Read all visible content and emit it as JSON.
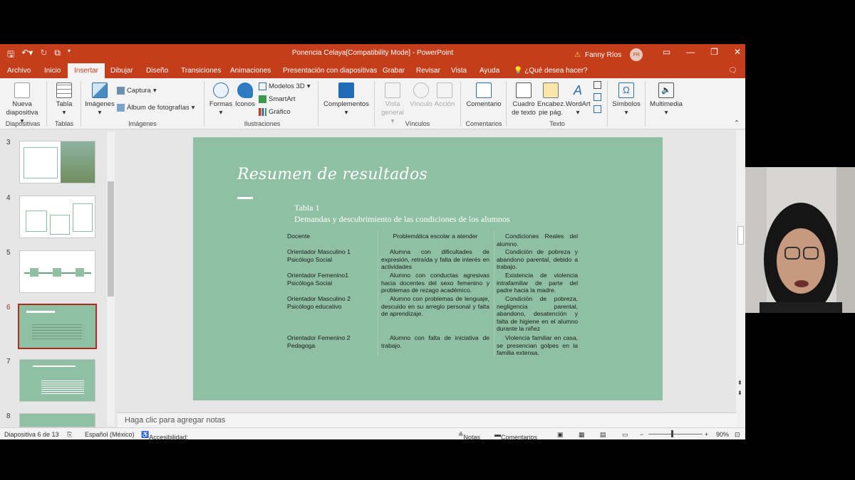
{
  "window": {
    "title": "Ponencia Celaya[Compatibility Mode]  -  PowerPoint",
    "user_name": "Fanny Ríos",
    "user_initials": "FR"
  },
  "menu_tabs": [
    "Archivo",
    "Inicio",
    "Insertar",
    "Dibujar",
    "Diseño",
    "Transiciones",
    "Animaciones",
    "Presentación con diapositivas",
    "Grabar",
    "Revisar",
    "Vista",
    "Ayuda"
  ],
  "tell_me": "¿Qué desea hacer?",
  "ribbon": {
    "nueva_diapositiva": [
      "Nueva",
      "diapositiva"
    ],
    "tabla": "Tabla",
    "imagenes": "Imágenes",
    "captura": "Captura",
    "album": "Álbum de fotografías",
    "formas": "Formas",
    "iconos": "Iconos",
    "modelos3d": "Modelos 3D",
    "smartart": "SmartArt",
    "grafico": "Gráfico",
    "complementos": "Complementos",
    "vista_general": [
      "Vista",
      "general"
    ],
    "vinculo": "Vínculo",
    "accion": "Acción",
    "comentario": "Comentario",
    "cuadro_texto": [
      "Cuadro",
      "de texto"
    ],
    "encabez": [
      "Encabez.",
      "pie pág."
    ],
    "wordart": "WordArt",
    "simbolos": "Símbolos",
    "multimedia": "Multimedia",
    "groups": [
      "Diapositivas",
      "Tablas",
      "Imágenes",
      "Ilustraciones",
      "Vínculos",
      "Comentarios",
      "Texto"
    ]
  },
  "thumbnails": [
    "3",
    "4",
    "5",
    "6",
    "7",
    "8"
  ],
  "slide": {
    "title": "Resumen de resultados",
    "caption_1": "Tabla 1",
    "caption_2": "Demandas y descubrimiento de las condiciones de los alumnos",
    "headers": [
      "Docente",
      "Problemática escolar a atender",
      "Condiciones Reales del alumno."
    ],
    "rows": [
      [
        "Orientador Masculino 1\nPsicólogo Social",
        "Alumna con dificultades de expresión, retraída y falta de interés en actividades",
        "Condición de pobreza y abandono parental, debido a trabajo."
      ],
      [
        "Orientador Femenino1\nPsicóloga Social",
        "Alumno con conductas agresivas hacia docentes del sexo femenino y problemas de rezago académico.",
        "Existencia de violencia intrafamiliar de parte del padre hacia la madre."
      ],
      [
        "Orientador Masculino 2\nPsicólogo educativo",
        "Alumno con problemas de lenguaje, descuido en su arreglo personal y falta de aprendizaje.",
        "Condición de pobreza, negligencia parental, abandono, desatención y falta de higiene en el alumno durante la niñez"
      ],
      [
        "Orientador Femenino 2\nPedagoga",
        "Alumno con falta de iniciativa de trabajo.",
        "Violencia familiar en casa, se presencian golpes en la familia extensa."
      ]
    ]
  },
  "notes_placeholder": "Haga clic para agregar notas",
  "status": {
    "slide_count": "Diapositiva 6 de 13",
    "language": "Español (México)",
    "accessibility": "Accesibilidad: No disponible",
    "notes": "Notas",
    "comments": "Comentarios",
    "zoom": "90%"
  }
}
